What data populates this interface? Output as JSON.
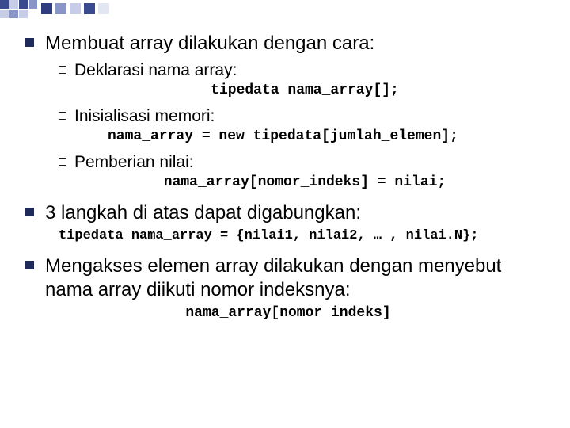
{
  "bullets": {
    "b1": {
      "text": "Membuat array dilakukan dengan cara:"
    },
    "b1_sub": {
      "s1": {
        "label": "Deklarasi",
        "rest": " nama array:",
        "code": "tipedata nama_array[];"
      },
      "s2": {
        "label": "Inisialisasi",
        "rest": " memori:",
        "code": "nama_array = new tipedata[jumlah_elemen];"
      },
      "s3": {
        "label": "Pemberian",
        "rest": " nilai:",
        "code": "nama_array[nomor_indeks] = nilai;"
      }
    },
    "b2": {
      "text": "3 langkah di atas dapat digabungkan:",
      "code": "tipedata nama_array = {nilai1, nilai2, … , nilai.N};"
    },
    "b3": {
      "text": "Mengakses elemen array dilakukan dengan menyebut nama array diikuti nomor indeksnya:",
      "code": "nama_array[nomor indeks]"
    }
  }
}
